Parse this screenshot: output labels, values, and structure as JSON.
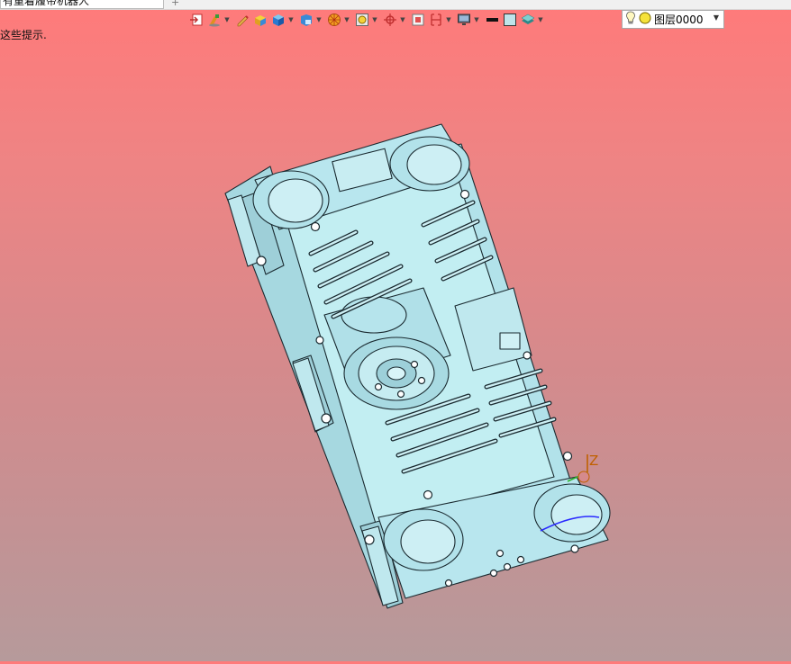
{
  "document_tab": {
    "title": "有重着履带机器人",
    "close_label": "×"
  },
  "hint": {
    "text": "这些提示."
  },
  "toolbar": {
    "icons": [
      "exit-sketch-icon",
      "paint-icon",
      "pencil-icon",
      "shade-solid-icon",
      "cube-icon",
      "box-view-icon",
      "section-icon",
      "zoom-icon",
      "orient-icon",
      "snap-box-icon",
      "dimension-icon",
      "monitor-icon",
      "line-color-icon",
      "fill-color-icon",
      "layers-icon"
    ]
  },
  "layer": {
    "name": "图层0000"
  },
  "viewport": {
    "axis_label": "Z"
  },
  "colors": {
    "part": "#b2e2ea",
    "part_edge": "#1a2a30",
    "axis_z": "#c06000",
    "axis_x": "#2a2aff",
    "axis_y": "#2bb32b"
  }
}
